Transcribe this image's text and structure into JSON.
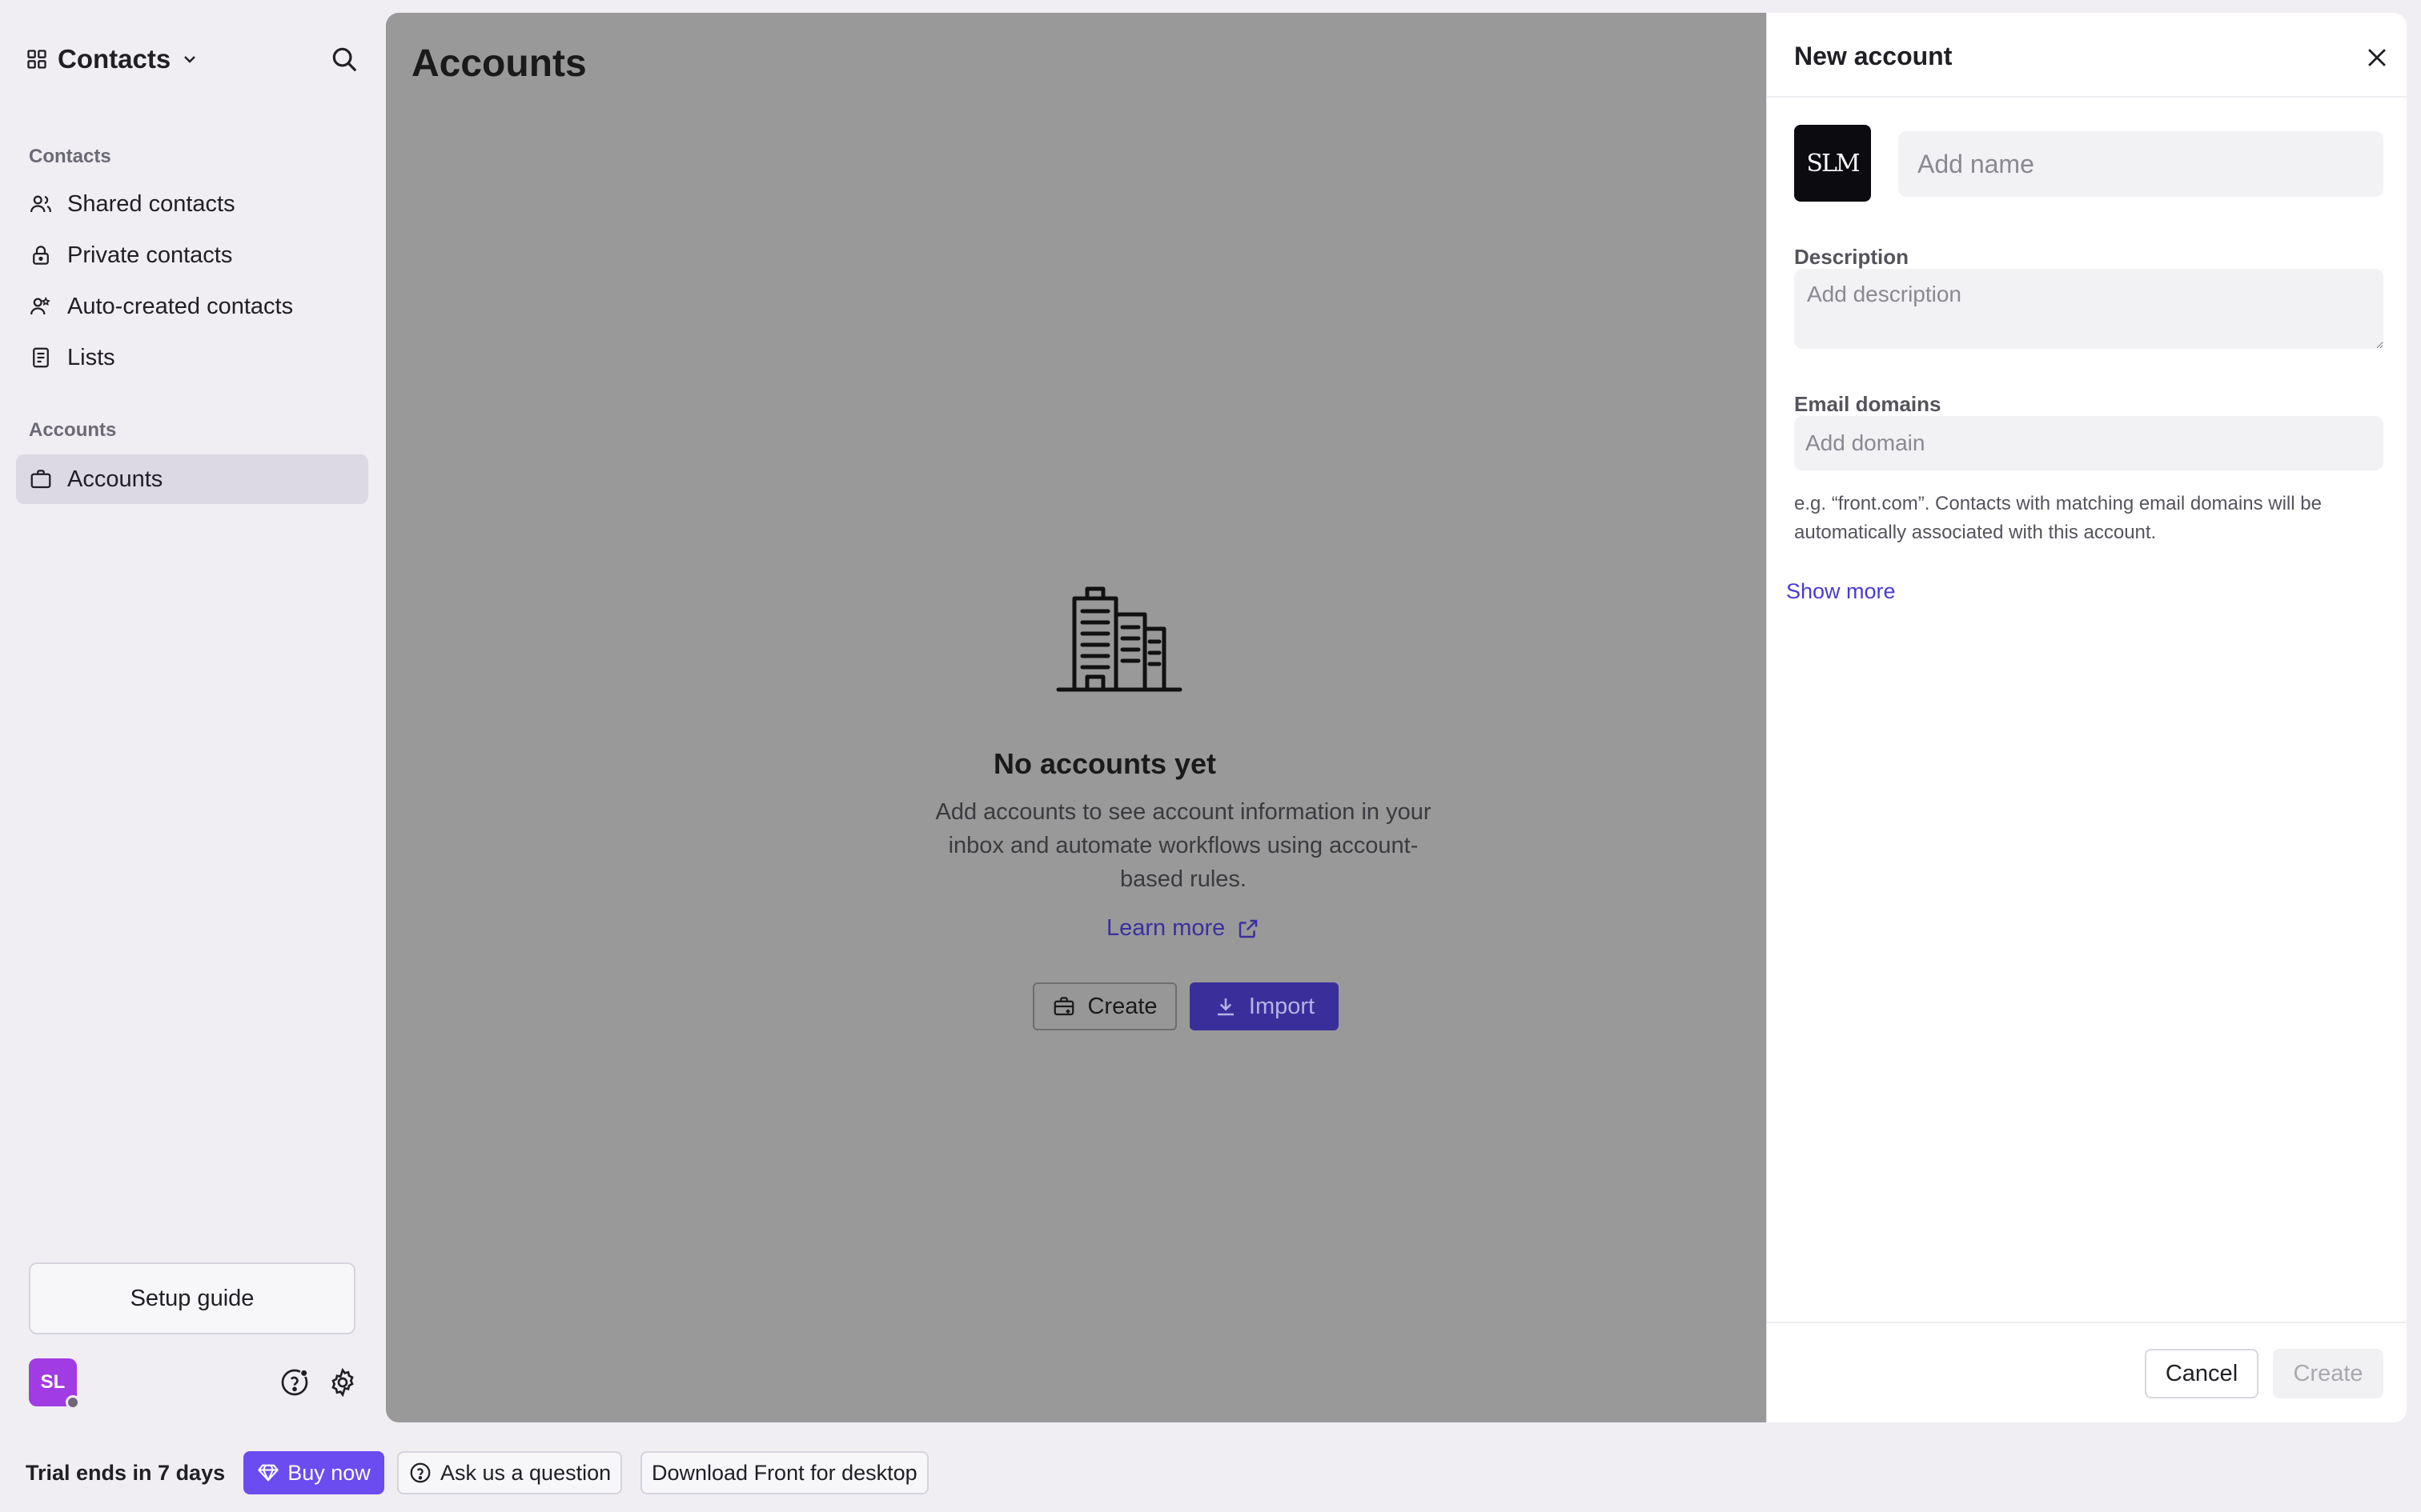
{
  "sidebar": {
    "app_title": "Contacts",
    "sections": {
      "contacts": "Contacts",
      "accounts": "Accounts"
    },
    "items": [
      {
        "label": "Shared contacts",
        "icon": "users-icon"
      },
      {
        "label": "Private contacts",
        "icon": "lock-icon"
      },
      {
        "label": "Auto-created contacts",
        "icon": "user-auto-icon"
      },
      {
        "label": "Lists",
        "icon": "list-icon"
      },
      {
        "label": "Accounts",
        "icon": "briefcase-icon",
        "active": true
      }
    ],
    "setup_guide": "Setup guide",
    "avatar_initials": "SL"
  },
  "main": {
    "title": "Accounts",
    "empty_state": {
      "heading": "No accounts yet",
      "description": "Add accounts to see account information in your inbox and automate workflows using account-based rules.",
      "learn_more": "Learn more",
      "create_label": "Create",
      "import_label": "Import"
    }
  },
  "panel": {
    "title": "New account",
    "logo_text": "SLM",
    "name_placeholder": "Add name",
    "description_label": "Description",
    "description_placeholder": "Add description",
    "email_domains_label": "Email domains",
    "domain_placeholder": "Add domain",
    "domain_hint": "e.g. “front.com”. Contacts with matching email domains will be automatically associated with this account.",
    "show_more": "Show more",
    "cancel_label": "Cancel",
    "create_label": "Create"
  },
  "bottom_bar": {
    "trial_text": "Trial ends in 7 days",
    "buy_now": "Buy now",
    "ask_question": "Ask us a question",
    "download": "Download Front for desktop"
  },
  "colors": {
    "accent": "#6a4cf0",
    "overlay": "#999999",
    "link": "#4a3bd1",
    "avatar": "#a13be3"
  }
}
